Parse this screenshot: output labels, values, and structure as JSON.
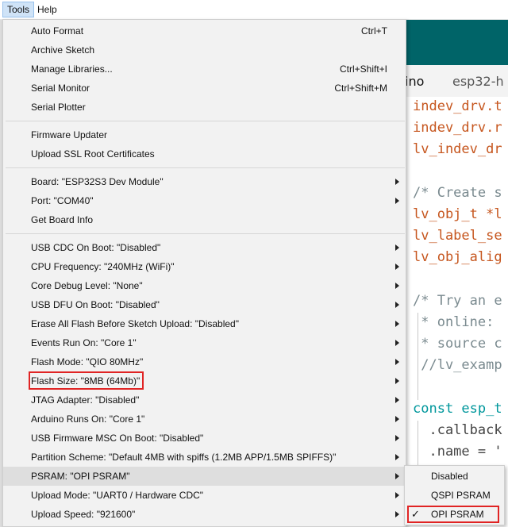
{
  "menubar": {
    "tools": "Tools",
    "help": "Help"
  },
  "editor": {
    "tabs": [
      "ino",
      "esp32-h"
    ],
    "lines": [
      {
        "text": "indev_drv.t",
        "kind": "fn"
      },
      {
        "text": "indev_drv.r",
        "kind": "fn"
      },
      {
        "text": "lv_indev_dr",
        "kind": "fn"
      },
      {
        "text": "",
        "kind": "pl"
      },
      {
        "text": "/* Create s",
        "kind": "cm"
      },
      {
        "text": "lv_obj_t *l",
        "kind": "fn"
      },
      {
        "text": "lv_label_se",
        "kind": "fn"
      },
      {
        "text": "lv_obj_alig",
        "kind": "fn"
      },
      {
        "text": "",
        "kind": "pl"
      },
      {
        "text": "/* Try an e",
        "kind": "cm"
      },
      {
        "text": " * online: ",
        "kind": "cm"
      },
      {
        "text": " * source c",
        "kind": "cm"
      },
      {
        "text": " //lv_examp",
        "kind": "cm"
      },
      {
        "text": "",
        "kind": "pl"
      },
      {
        "text": "const esp_t",
        "kind": "kw"
      },
      {
        "text": "  .callback",
        "kind": "pl"
      },
      {
        "text": "  .name = '",
        "kind": "pl"
      }
    ]
  },
  "menu": {
    "items": [
      {
        "label": "Auto Format",
        "shortcut": "Ctrl+T"
      },
      {
        "label": "Archive Sketch",
        "shortcut": ""
      },
      {
        "label": "Manage Libraries...",
        "shortcut": "Ctrl+Shift+I"
      },
      {
        "label": "Serial Monitor",
        "shortcut": "Ctrl+Shift+M"
      },
      {
        "label": "Serial Plotter",
        "shortcut": ""
      },
      {
        "label": "Firmware Updater",
        "shortcut": ""
      },
      {
        "label": "Upload SSL Root Certificates",
        "shortcut": ""
      },
      {
        "label": "Board: \"ESP32S3 Dev Module\"",
        "shortcut": ""
      },
      {
        "label": "Port: \"COM40\"",
        "shortcut": ""
      },
      {
        "label": "Get Board Info",
        "shortcut": ""
      },
      {
        "label": "USB CDC On Boot: \"Disabled\"",
        "shortcut": ""
      },
      {
        "label": "CPU Frequency: \"240MHz (WiFi)\"",
        "shortcut": ""
      },
      {
        "label": "Core Debug Level: \"None\"",
        "shortcut": ""
      },
      {
        "label": "USB DFU On Boot: \"Disabled\"",
        "shortcut": ""
      },
      {
        "label": "Erase All Flash Before Sketch Upload: \"Disabled\"",
        "shortcut": ""
      },
      {
        "label": "Events Run On: \"Core 1\"",
        "shortcut": ""
      },
      {
        "label": "Flash Mode: \"QIO 80MHz\"",
        "shortcut": ""
      },
      {
        "label": "Flash Size: \"8MB (64Mb)\"",
        "shortcut": ""
      },
      {
        "label": "JTAG Adapter: \"Disabled\"",
        "shortcut": ""
      },
      {
        "label": "Arduino Runs On: \"Core 1\"",
        "shortcut": ""
      },
      {
        "label": "USB Firmware MSC On Boot: \"Disabled\"",
        "shortcut": ""
      },
      {
        "label": "Partition Scheme: \"Default 4MB with spiffs (1.2MB APP/1.5MB SPIFFS)\"",
        "shortcut": ""
      },
      {
        "label": "PSRAM: \"OPI PSRAM\"",
        "shortcut": ""
      },
      {
        "label": "Upload Mode: \"UART0 / Hardware CDC\"",
        "shortcut": ""
      },
      {
        "label": "Upload Speed: \"921600\"",
        "shortcut": ""
      }
    ]
  },
  "psram_submenu": {
    "items": [
      {
        "label": "Disabled"
      },
      {
        "label": "QSPI PSRAM"
      },
      {
        "label": "OPI PSRAM"
      }
    ],
    "check_glyph": "✓"
  },
  "colors": {
    "highlight_box": "#e02424",
    "ide_teal": "#006468",
    "code_orange": "#c6561e"
  }
}
